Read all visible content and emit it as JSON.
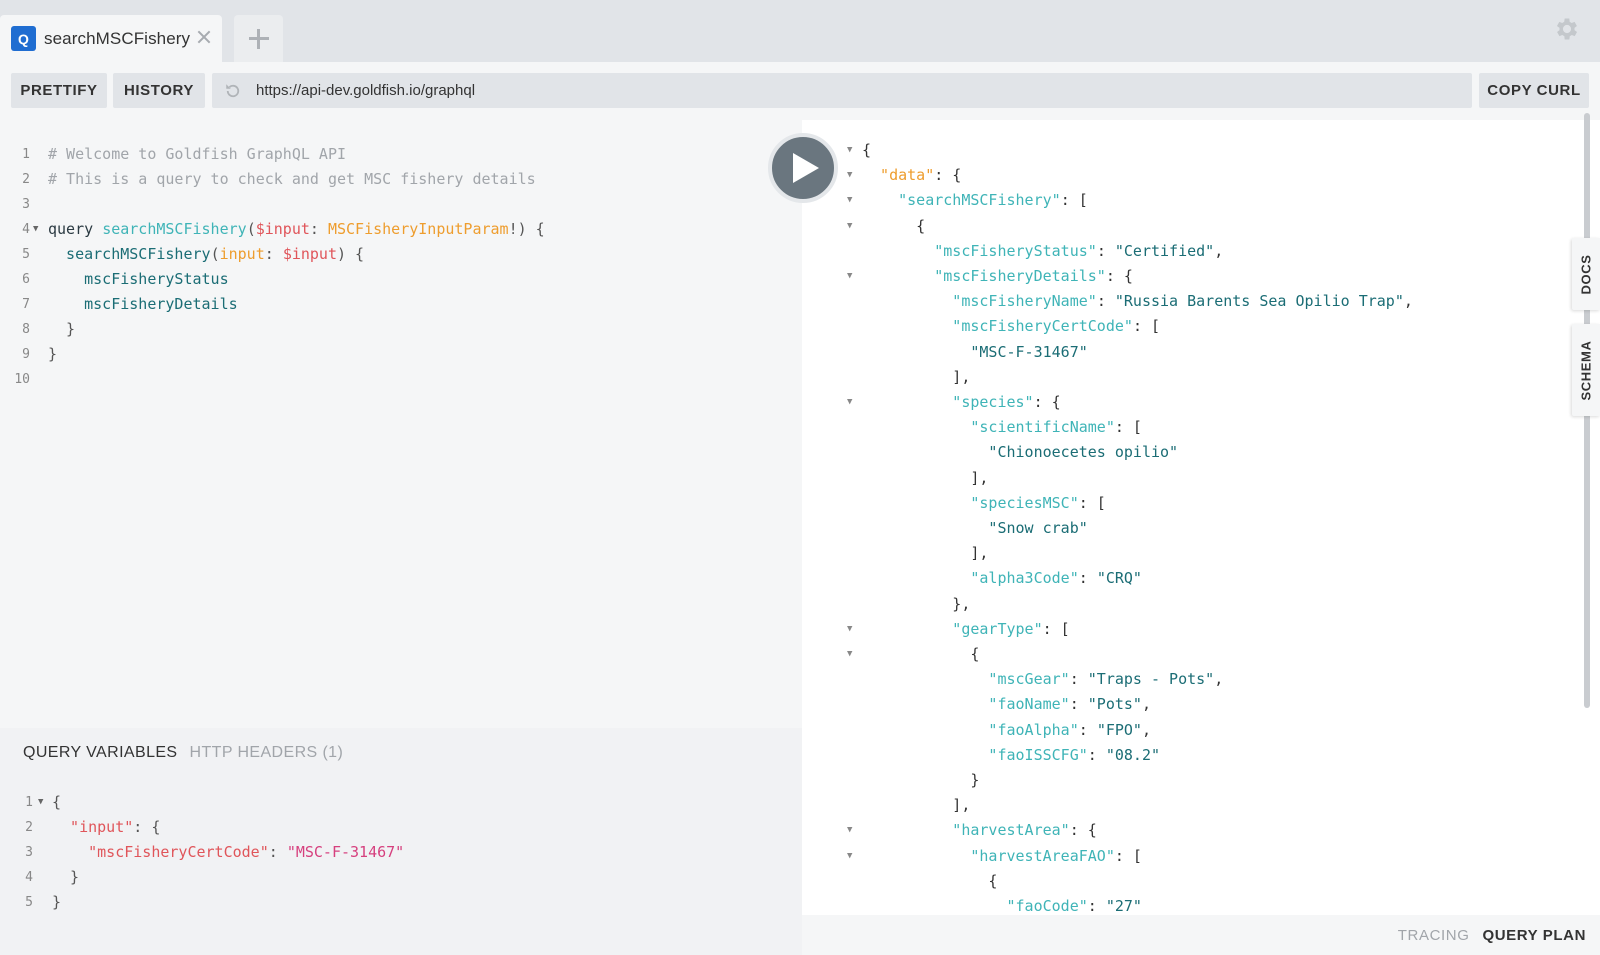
{
  "tab": {
    "badge": "Q",
    "title": "searchMSCFishery"
  },
  "toolbar": {
    "prettify_label": "PRETTIFY",
    "history_label": "HISTORY",
    "url": "https://api-dev.goldfish.io/graphql",
    "copy_curl_label": "COPY CURL"
  },
  "query_lines": [
    {
      "n": "1",
      "fold": "",
      "parts": [
        {
          "t": "# Welcome to Goldfish GraphQL API",
          "c": "c-comment"
        }
      ]
    },
    {
      "n": "2",
      "fold": "",
      "parts": [
        {
          "t": "# This is a query to check and get MSC fishery details",
          "c": "c-comment"
        }
      ]
    },
    {
      "n": "3",
      "fold": "",
      "parts": []
    },
    {
      "n": "4",
      "fold": "▼",
      "parts": [
        {
          "t": "query ",
          "c": "c-keyword"
        },
        {
          "t": "searchMSCFishery",
          "c": "c-def"
        },
        {
          "t": "(",
          "c": "c-punc"
        },
        {
          "t": "$input",
          "c": "c-var"
        },
        {
          "t": ": ",
          "c": "c-punc"
        },
        {
          "t": "MSCFisheryInputParam",
          "c": "c-type"
        },
        {
          "t": "!) {",
          "c": "c-punc"
        }
      ]
    },
    {
      "n": "5",
      "fold": "",
      "parts": [
        {
          "t": "  searchMSCFishery",
          "c": "c-field"
        },
        {
          "t": "(",
          "c": "c-punc"
        },
        {
          "t": "input",
          "c": "c-type"
        },
        {
          "t": ": ",
          "c": "c-punc"
        },
        {
          "t": "$input",
          "c": "c-var"
        },
        {
          "t": ") {",
          "c": "c-punc"
        }
      ]
    },
    {
      "n": "6",
      "fold": "",
      "parts": [
        {
          "t": "    mscFisheryStatus",
          "c": "c-field"
        }
      ]
    },
    {
      "n": "7",
      "fold": "",
      "parts": [
        {
          "t": "    mscFisheryDetails",
          "c": "c-field"
        }
      ]
    },
    {
      "n": "8",
      "fold": "",
      "parts": [
        {
          "t": "  }",
          "c": "c-punc"
        }
      ]
    },
    {
      "n": "9",
      "fold": "",
      "parts": [
        {
          "t": "}",
          "c": "c-punc"
        }
      ]
    },
    {
      "n": "10",
      "fold": "",
      "parts": []
    }
  ],
  "variables": {
    "tab_active": "QUERY VARIABLES",
    "tab_headers": "HTTP HEADERS (1)",
    "lines": [
      {
        "n": "1",
        "fold": "▼",
        "parts": [
          {
            "t": "{",
            "c": "c-punc"
          }
        ]
      },
      {
        "n": "2",
        "fold": "",
        "parts": [
          {
            "t": "  \"input\"",
            "c": "c-prop"
          },
          {
            "t": ": {",
            "c": "c-punc"
          }
        ]
      },
      {
        "n": "3",
        "fold": "",
        "parts": [
          {
            "t": "    \"mscFisheryCertCode\"",
            "c": "c-prop"
          },
          {
            "t": ": ",
            "c": "c-punc"
          },
          {
            "t": "\"MSC-F-31467\"",
            "c": "c-str2"
          }
        ]
      },
      {
        "n": "4",
        "fold": "",
        "parts": [
          {
            "t": "  }",
            "c": "c-punc"
          }
        ]
      },
      {
        "n": "5",
        "fold": "",
        "parts": [
          {
            "t": "}",
            "c": "c-punc"
          }
        ]
      }
    ]
  },
  "result_lines": [
    {
      "fold": "▼",
      "parts": [
        {
          "t": "{",
          "c": "r-punc"
        }
      ]
    },
    {
      "fold": "▼",
      "parts": [
        {
          "t": "  \"data\"",
          "c": "r-data"
        },
        {
          "t": ": {",
          "c": "r-punc"
        }
      ]
    },
    {
      "fold": "▼",
      "parts": [
        {
          "t": "    \"searchMSCFishery\"",
          "c": "r-key"
        },
        {
          "t": ": [",
          "c": "r-punc"
        }
      ]
    },
    {
      "fold": "▼",
      "parts": [
        {
          "t": "      {",
          "c": "r-punc"
        }
      ]
    },
    {
      "fold": "",
      "parts": [
        {
          "t": "        \"mscFisheryStatus\"",
          "c": "r-key"
        },
        {
          "t": ": ",
          "c": "r-punc"
        },
        {
          "t": "\"Certified\"",
          "c": "r-str"
        },
        {
          "t": ",",
          "c": "r-punc"
        }
      ]
    },
    {
      "fold": "▼",
      "parts": [
        {
          "t": "        \"mscFisheryDetails\"",
          "c": "r-key"
        },
        {
          "t": ": {",
          "c": "r-punc"
        }
      ]
    },
    {
      "fold": "",
      "parts": [
        {
          "t": "          \"mscFisheryName\"",
          "c": "r-key"
        },
        {
          "t": ": ",
          "c": "r-punc"
        },
        {
          "t": "\"Russia Barents Sea Opilio Trap\"",
          "c": "r-str"
        },
        {
          "t": ",",
          "c": "r-punc"
        }
      ]
    },
    {
      "fold": "",
      "parts": [
        {
          "t": "          \"mscFisheryCertCode\"",
          "c": "r-key"
        },
        {
          "t": ": [",
          "c": "r-punc"
        }
      ]
    },
    {
      "fold": "",
      "parts": [
        {
          "t": "            \"MSC-F-31467\"",
          "c": "r-str"
        }
      ]
    },
    {
      "fold": "",
      "parts": [
        {
          "t": "          ],",
          "c": "r-punc"
        }
      ]
    },
    {
      "fold": "▼",
      "parts": [
        {
          "t": "          \"species\"",
          "c": "r-key"
        },
        {
          "t": ": {",
          "c": "r-punc"
        }
      ]
    },
    {
      "fold": "",
      "parts": [
        {
          "t": "            \"scientificName\"",
          "c": "r-key"
        },
        {
          "t": ": [",
          "c": "r-punc"
        }
      ]
    },
    {
      "fold": "",
      "parts": [
        {
          "t": "              \"Chionoecetes opilio\"",
          "c": "r-str"
        }
      ]
    },
    {
      "fold": "",
      "parts": [
        {
          "t": "            ],",
          "c": "r-punc"
        }
      ]
    },
    {
      "fold": "",
      "parts": [
        {
          "t": "            \"speciesMSC\"",
          "c": "r-key"
        },
        {
          "t": ": [",
          "c": "r-punc"
        }
      ]
    },
    {
      "fold": "",
      "parts": [
        {
          "t": "              \"Snow crab\"",
          "c": "r-str"
        }
      ]
    },
    {
      "fold": "",
      "parts": [
        {
          "t": "            ],",
          "c": "r-punc"
        }
      ]
    },
    {
      "fold": "",
      "parts": [
        {
          "t": "            \"alpha3Code\"",
          "c": "r-key"
        },
        {
          "t": ": ",
          "c": "r-punc"
        },
        {
          "t": "\"CRQ\"",
          "c": "r-str"
        }
      ]
    },
    {
      "fold": "",
      "parts": [
        {
          "t": "          },",
          "c": "r-punc"
        }
      ]
    },
    {
      "fold": "▼",
      "parts": [
        {
          "t": "          \"gearType\"",
          "c": "r-key"
        },
        {
          "t": ": [",
          "c": "r-punc"
        }
      ]
    },
    {
      "fold": "▼",
      "parts": [
        {
          "t": "            {",
          "c": "r-punc"
        }
      ]
    },
    {
      "fold": "",
      "parts": [
        {
          "t": "              \"mscGear\"",
          "c": "r-key"
        },
        {
          "t": ": ",
          "c": "r-punc"
        },
        {
          "t": "\"Traps - Pots\"",
          "c": "r-str"
        },
        {
          "t": ",",
          "c": "r-punc"
        }
      ]
    },
    {
      "fold": "",
      "parts": [
        {
          "t": "              \"faoName\"",
          "c": "r-key"
        },
        {
          "t": ": ",
          "c": "r-punc"
        },
        {
          "t": "\"Pots\"",
          "c": "r-str"
        },
        {
          "t": ",",
          "c": "r-punc"
        }
      ]
    },
    {
      "fold": "",
      "parts": [
        {
          "t": "              \"faoAlpha\"",
          "c": "r-key"
        },
        {
          "t": ": ",
          "c": "r-punc"
        },
        {
          "t": "\"FPO\"",
          "c": "r-str"
        },
        {
          "t": ",",
          "c": "r-punc"
        }
      ]
    },
    {
      "fold": "",
      "parts": [
        {
          "t": "              \"faoISSCFG\"",
          "c": "r-key"
        },
        {
          "t": ": ",
          "c": "r-punc"
        },
        {
          "t": "\"08.2\"",
          "c": "r-str"
        }
      ]
    },
    {
      "fold": "",
      "parts": [
        {
          "t": "            }",
          "c": "r-punc"
        }
      ]
    },
    {
      "fold": "",
      "parts": [
        {
          "t": "          ],",
          "c": "r-punc"
        }
      ]
    },
    {
      "fold": "▼",
      "parts": [
        {
          "t": "          \"harvestArea\"",
          "c": "r-key"
        },
        {
          "t": ": {",
          "c": "r-punc"
        }
      ]
    },
    {
      "fold": "▼",
      "parts": [
        {
          "t": "            \"harvestAreaFAO\"",
          "c": "r-key"
        },
        {
          "t": ": [",
          "c": "r-punc"
        }
      ]
    },
    {
      "fold": "",
      "parts": [
        {
          "t": "              {",
          "c": "r-punc"
        }
      ]
    },
    {
      "fold": "",
      "parts": [
        {
          "t": "                \"faoCode\"",
          "c": "r-key"
        },
        {
          "t": ": ",
          "c": "r-punc"
        },
        {
          "t": "\"27\"",
          "c": "r-str"
        }
      ]
    }
  ],
  "side_tabs": {
    "docs": "DOCS",
    "schema": "SCHEMA"
  },
  "footer": {
    "tracing": "TRACING",
    "query_plan": "QUERY PLAN"
  },
  "colors": {
    "accent": "#1f6dd1",
    "run_button": "#6a767f"
  }
}
